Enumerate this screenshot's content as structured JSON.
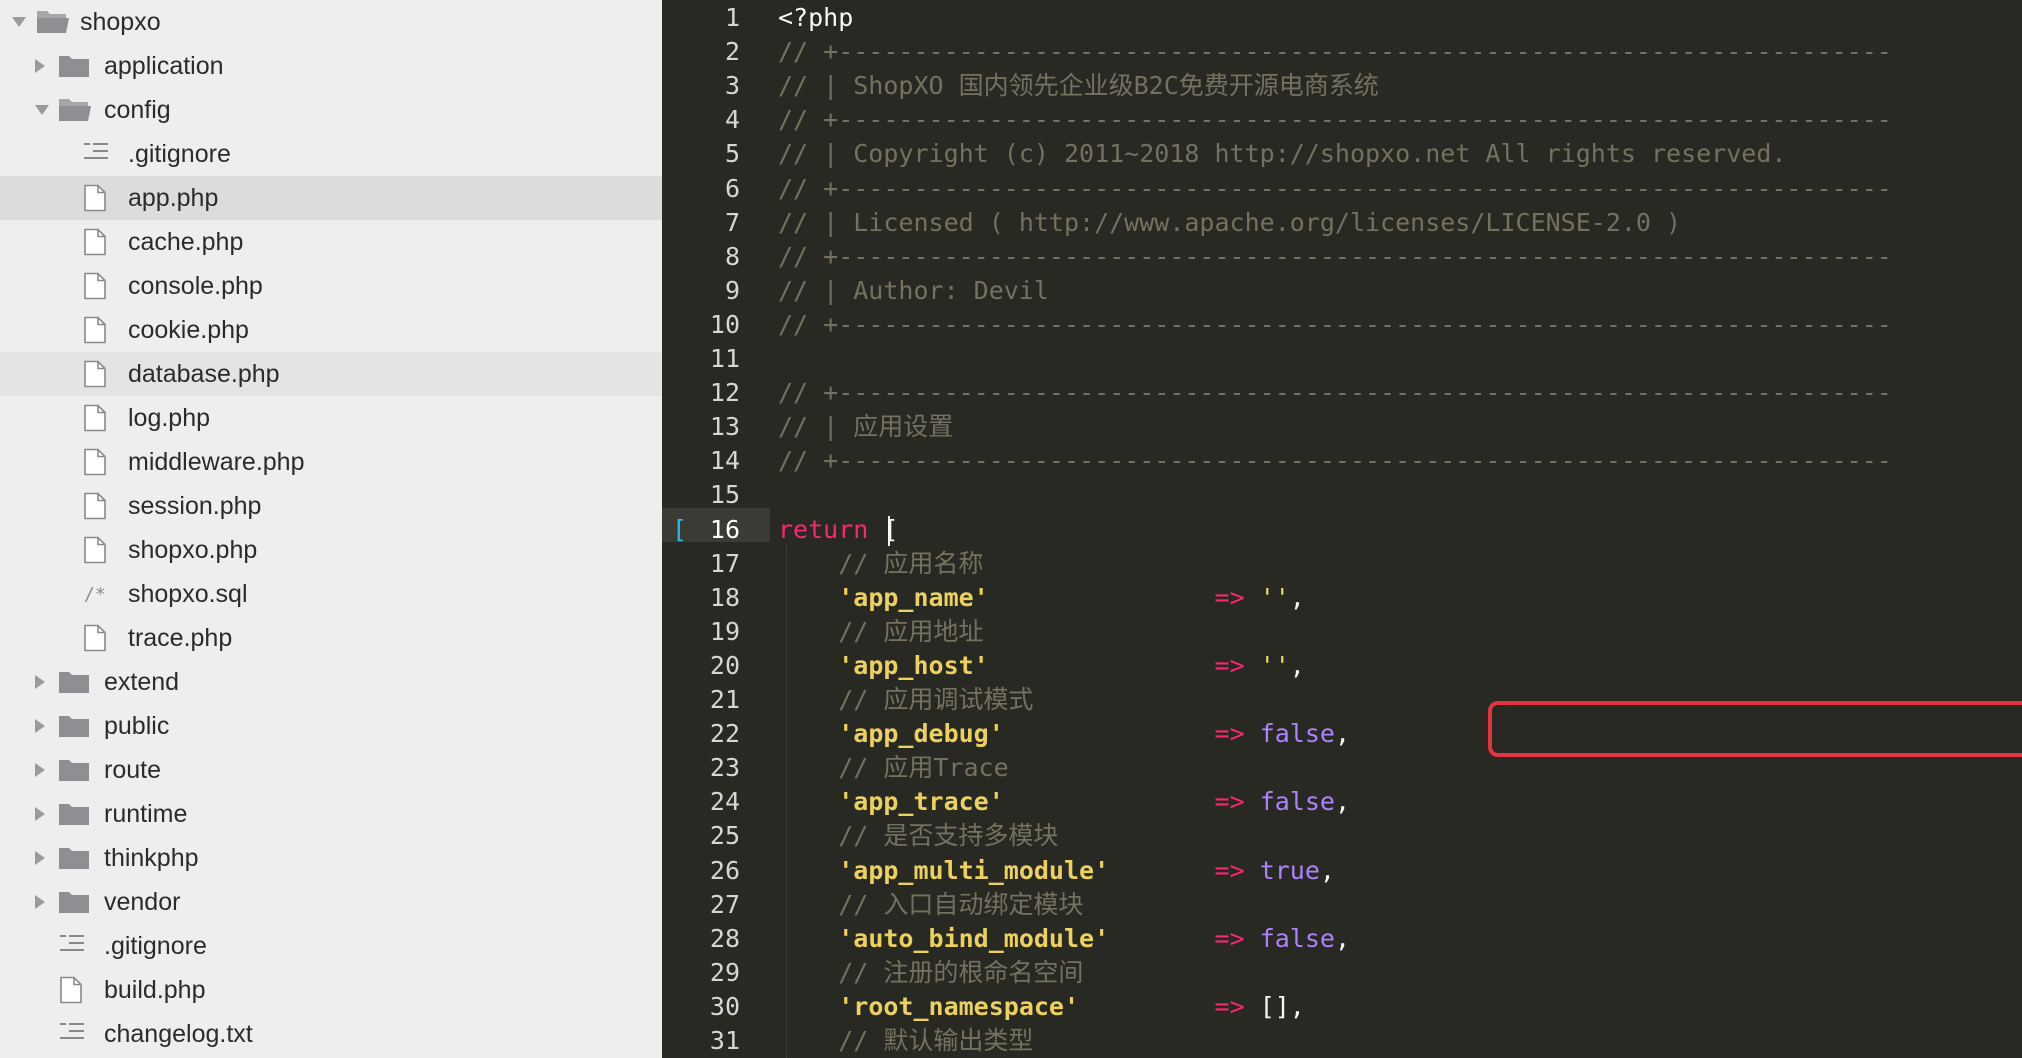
{
  "sidebar": {
    "items": [
      {
        "label": "shopxo",
        "kind": "folder-open",
        "arrow": "down",
        "depth": 0
      },
      {
        "label": "application",
        "kind": "folder",
        "arrow": "right",
        "depth": 1
      },
      {
        "label": "config",
        "kind": "folder-open",
        "arrow": "down",
        "depth": 1
      },
      {
        "label": ".gitignore",
        "kind": "text-icon",
        "arrow": "",
        "depth": 2
      },
      {
        "label": "app.php",
        "kind": "file",
        "arrow": "",
        "depth": 2,
        "state": "selected"
      },
      {
        "label": "cache.php",
        "kind": "file",
        "arrow": "",
        "depth": 2
      },
      {
        "label": "console.php",
        "kind": "file",
        "arrow": "",
        "depth": 2
      },
      {
        "label": "cookie.php",
        "kind": "file",
        "arrow": "",
        "depth": 2
      },
      {
        "label": "database.php",
        "kind": "file",
        "arrow": "",
        "depth": 2,
        "state": "hover"
      },
      {
        "label": "log.php",
        "kind": "file",
        "arrow": "",
        "depth": 2
      },
      {
        "label": "middleware.php",
        "kind": "file",
        "arrow": "",
        "depth": 2
      },
      {
        "label": "session.php",
        "kind": "file",
        "arrow": "",
        "depth": 2
      },
      {
        "label": "shopxo.php",
        "kind": "file",
        "arrow": "",
        "depth": 2
      },
      {
        "label": "shopxo.sql",
        "kind": "sql-icon",
        "arrow": "",
        "depth": 2
      },
      {
        "label": "trace.php",
        "kind": "file",
        "arrow": "",
        "depth": 2
      },
      {
        "label": "extend",
        "kind": "folder",
        "arrow": "right",
        "depth": 1
      },
      {
        "label": "public",
        "kind": "folder",
        "arrow": "right",
        "depth": 1
      },
      {
        "label": "route",
        "kind": "folder",
        "arrow": "right",
        "depth": 1
      },
      {
        "label": "runtime",
        "kind": "folder",
        "arrow": "right",
        "depth": 1
      },
      {
        "label": "thinkphp",
        "kind": "folder",
        "arrow": "right",
        "depth": 1
      },
      {
        "label": "vendor",
        "kind": "folder",
        "arrow": "right",
        "depth": 1
      },
      {
        "label": ".gitignore",
        "kind": "text-icon",
        "arrow": "",
        "depth": 1
      },
      {
        "label": "build.php",
        "kind": "file",
        "arrow": "",
        "depth": 1
      },
      {
        "label": "changelog.txt",
        "kind": "text-icon",
        "arrow": "",
        "depth": 1
      }
    ]
  },
  "editor": {
    "current_line": 16,
    "lines": [
      [
        {
          "t": "<?php",
          "c": "plain"
        }
      ],
      [
        {
          "t": "// +----------------------------------------------------------------------",
          "c": "cmt"
        }
      ],
      [
        {
          "t": "// | ShopXO 国内领先企业级B2C免费开源电商系统",
          "c": "cmt"
        }
      ],
      [
        {
          "t": "// +----------------------------------------------------------------------",
          "c": "cmt"
        }
      ],
      [
        {
          "t": "// | Copyright (c) 2011~2018 http://shopxo.net All rights reserved.",
          "c": "cmt"
        }
      ],
      [
        {
          "t": "// +----------------------------------------------------------------------",
          "c": "cmt"
        }
      ],
      [
        {
          "t": "// | Licensed ( http://www.apache.org/licenses/LICENSE-2.0 )",
          "c": "cmt"
        }
      ],
      [
        {
          "t": "// +----------------------------------------------------------------------",
          "c": "cmt"
        }
      ],
      [
        {
          "t": "// | Author: Devil",
          "c": "cmt"
        }
      ],
      [
        {
          "t": "// +----------------------------------------------------------------------",
          "c": "cmt"
        }
      ],
      [],
      [
        {
          "t": "// +----------------------------------------------------------------------",
          "c": "cmt"
        }
      ],
      [
        {
          "t": "// | 应用设置",
          "c": "cmt"
        }
      ],
      [
        {
          "t": "// +----------------------------------------------------------------------",
          "c": "cmt"
        }
      ],
      [],
      [
        {
          "t": "return ",
          "c": "kw"
        },
        {
          "t": "[",
          "c": "plain"
        }
      ],
      [
        {
          "t": "    // 应用名称",
          "c": "cmt"
        }
      ],
      [
        {
          "t": "    ",
          "c": "plain"
        },
        {
          "t": "'app_name'",
          "c": "str-b"
        },
        {
          "t": "               ",
          "c": "plain"
        },
        {
          "t": "=>",
          "c": "op"
        },
        {
          "t": " ",
          "c": "plain"
        },
        {
          "t": "''",
          "c": "str"
        },
        {
          "t": ",",
          "c": "plain"
        }
      ],
      [
        {
          "t": "    // 应用地址",
          "c": "cmt"
        }
      ],
      [
        {
          "t": "    ",
          "c": "plain"
        },
        {
          "t": "'app_host'",
          "c": "str-b"
        },
        {
          "t": "               ",
          "c": "plain"
        },
        {
          "t": "=>",
          "c": "op"
        },
        {
          "t": " ",
          "c": "plain"
        },
        {
          "t": "''",
          "c": "str"
        },
        {
          "t": ",",
          "c": "plain"
        }
      ],
      [
        {
          "t": "    // 应用调试模式",
          "c": "cmt"
        }
      ],
      [
        {
          "t": "    ",
          "c": "plain"
        },
        {
          "t": "'app_debug'",
          "c": "str-b"
        },
        {
          "t": "              ",
          "c": "plain"
        },
        {
          "t": "=>",
          "c": "op"
        },
        {
          "t": " ",
          "c": "plain"
        },
        {
          "t": "false",
          "c": "const"
        },
        {
          "t": ",",
          "c": "plain"
        }
      ],
      [
        {
          "t": "    // 应用Trace",
          "c": "cmt"
        }
      ],
      [
        {
          "t": "    ",
          "c": "plain"
        },
        {
          "t": "'app_trace'",
          "c": "str-b"
        },
        {
          "t": "              ",
          "c": "plain"
        },
        {
          "t": "=>",
          "c": "op"
        },
        {
          "t": " ",
          "c": "plain"
        },
        {
          "t": "false",
          "c": "const"
        },
        {
          "t": ",",
          "c": "plain"
        }
      ],
      [
        {
          "t": "    // 是否支持多模块",
          "c": "cmt"
        }
      ],
      [
        {
          "t": "    ",
          "c": "plain"
        },
        {
          "t": "'app_multi_module'",
          "c": "str-b"
        },
        {
          "t": "       ",
          "c": "plain"
        },
        {
          "t": "=>",
          "c": "op"
        },
        {
          "t": " ",
          "c": "plain"
        },
        {
          "t": "true",
          "c": "const"
        },
        {
          "t": ",",
          "c": "plain"
        }
      ],
      [
        {
          "t": "    // 入口自动绑定模块",
          "c": "cmt"
        }
      ],
      [
        {
          "t": "    ",
          "c": "plain"
        },
        {
          "t": "'auto_bind_module'",
          "c": "str-b"
        },
        {
          "t": "       ",
          "c": "plain"
        },
        {
          "t": "=>",
          "c": "op"
        },
        {
          "t": " ",
          "c": "plain"
        },
        {
          "t": "false",
          "c": "const"
        },
        {
          "t": ",",
          "c": "plain"
        }
      ],
      [
        {
          "t": "    // 注册的根命名空间",
          "c": "cmt"
        }
      ],
      [
        {
          "t": "    ",
          "c": "plain"
        },
        {
          "t": "'root_namespace'",
          "c": "str-b"
        },
        {
          "t": "         ",
          "c": "plain"
        },
        {
          "t": "=>",
          "c": "op"
        },
        {
          "t": " ",
          "c": "plain"
        },
        {
          "t": "[]",
          "c": "plain"
        },
        {
          "t": ",",
          "c": "plain"
        }
      ],
      [
        {
          "t": "    // 默认输出类型",
          "c": "cmt"
        }
      ]
    ]
  },
  "colors": {
    "editor_bg": "#282923",
    "sidebar_bg": "#eeeeee",
    "highlight_border": "#e53340",
    "keyword": "#f92672",
    "string": "#e6db74",
    "constant": "#ae81ff",
    "comment": "#75715e"
  }
}
